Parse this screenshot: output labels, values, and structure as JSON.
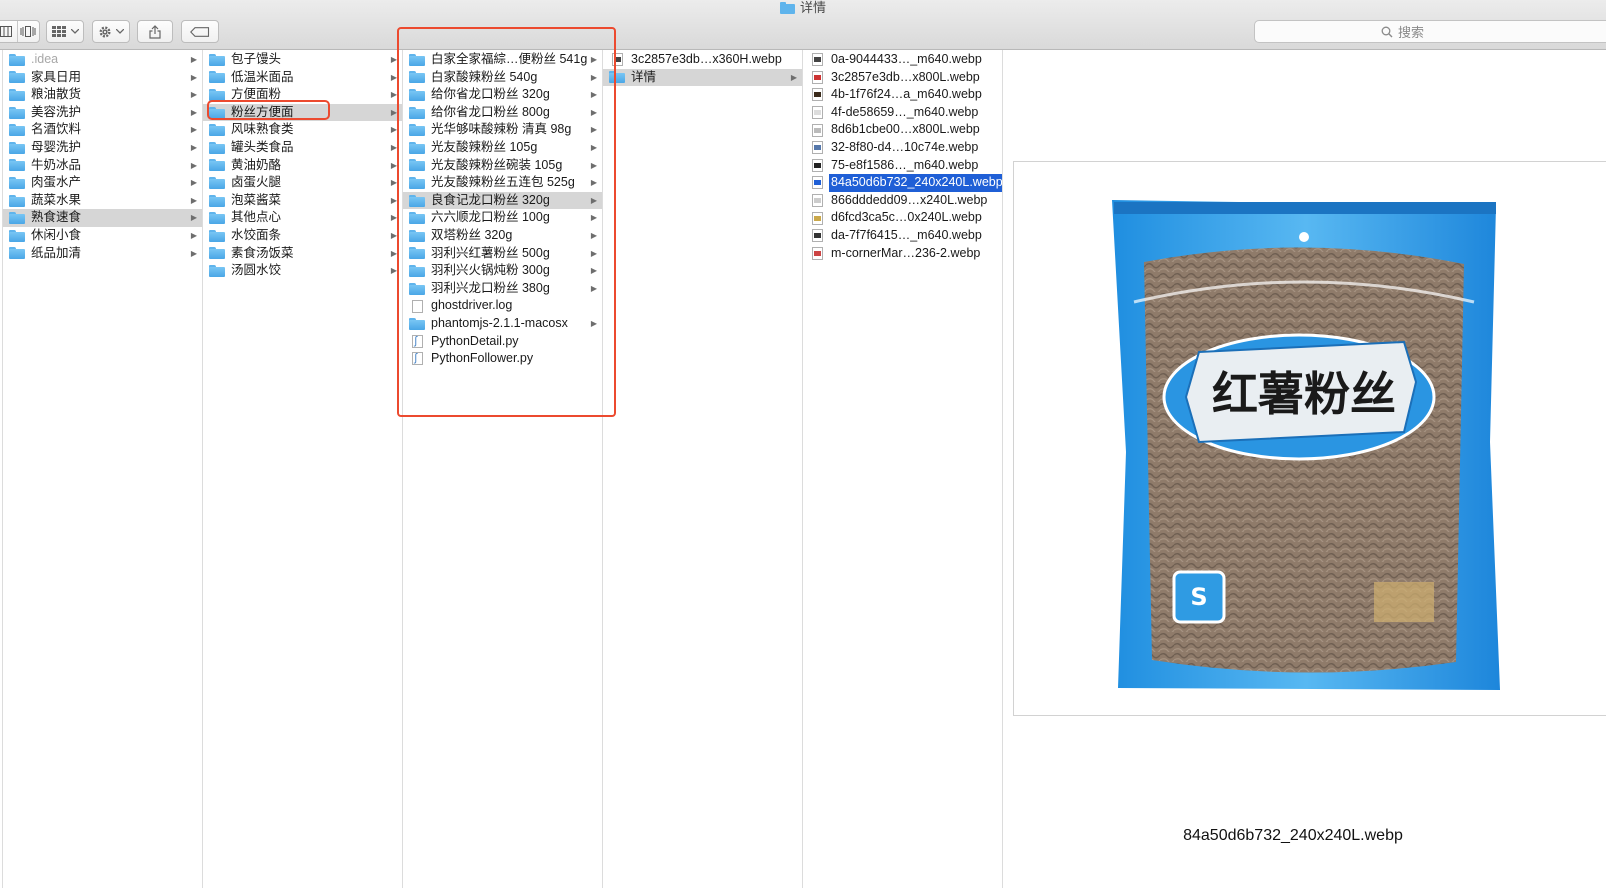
{
  "window": {
    "title": "详情"
  },
  "search": {
    "placeholder": "搜索"
  },
  "columns": {
    "c1": [
      {
        "label": ".idea",
        "kind": "folder",
        "dim": true,
        "arrow": true
      },
      {
        "label": "家具日用",
        "kind": "folder",
        "arrow": true
      },
      {
        "label": "粮油散货",
        "kind": "folder",
        "arrow": true
      },
      {
        "label": "美容洗护",
        "kind": "folder",
        "arrow": true
      },
      {
        "label": "名酒饮料",
        "kind": "folder",
        "arrow": true
      },
      {
        "label": "母婴洗护",
        "kind": "folder",
        "arrow": true
      },
      {
        "label": "牛奶冰品",
        "kind": "folder",
        "arrow": true
      },
      {
        "label": "肉蛋水产",
        "kind": "folder",
        "arrow": true
      },
      {
        "label": "蔬菜水果",
        "kind": "folder",
        "arrow": true
      },
      {
        "label": "熟食速食",
        "kind": "folder",
        "arrow": true,
        "selected": true
      },
      {
        "label": "休闲小食",
        "kind": "folder",
        "arrow": true
      },
      {
        "label": "纸品加清",
        "kind": "folder",
        "arrow": true
      }
    ],
    "c2": [
      {
        "label": "包子馒头",
        "kind": "folder",
        "arrow": true
      },
      {
        "label": "低温米面品",
        "kind": "folder",
        "arrow": true
      },
      {
        "label": "方便面粉",
        "kind": "folder",
        "arrow": true
      },
      {
        "label": "粉丝方便面",
        "kind": "folder",
        "arrow": true,
        "selected": true
      },
      {
        "label": "风味熟食类",
        "kind": "folder",
        "arrow": true
      },
      {
        "label": "罐头类食品",
        "kind": "folder",
        "arrow": true
      },
      {
        "label": "黄油奶酪",
        "kind": "folder",
        "arrow": true
      },
      {
        "label": "卤蛋火腿",
        "kind": "folder",
        "arrow": true
      },
      {
        "label": "泡菜酱菜",
        "kind": "folder",
        "arrow": true
      },
      {
        "label": "其他点心",
        "kind": "folder",
        "arrow": true
      },
      {
        "label": "水饺面条",
        "kind": "folder",
        "arrow": true
      },
      {
        "label": "素食汤饭菜",
        "kind": "folder",
        "arrow": true
      },
      {
        "label": "汤圆水饺",
        "kind": "folder",
        "arrow": true
      }
    ],
    "c3": [
      {
        "label": "白家全家福綜…便粉丝 541g",
        "kind": "folder",
        "arrow": true
      },
      {
        "label": "白家酸辣粉丝 540g",
        "kind": "folder",
        "arrow": true
      },
      {
        "label": "给你省龙口粉丝 320g",
        "kind": "folder",
        "arrow": true
      },
      {
        "label": "给你省龙口粉丝 800g",
        "kind": "folder",
        "arrow": true
      },
      {
        "label": "光华够味酸辣粉 清真 98g",
        "kind": "folder",
        "arrow": true
      },
      {
        "label": "光友酸辣粉丝 105g",
        "kind": "folder",
        "arrow": true
      },
      {
        "label": "光友酸辣粉丝碗装 105g",
        "kind": "folder",
        "arrow": true
      },
      {
        "label": "光友酸辣粉丝五连包 525g",
        "kind": "folder",
        "arrow": true
      },
      {
        "label": "良食记龙口粉丝 320g",
        "kind": "folder",
        "arrow": true,
        "selected": true
      },
      {
        "label": "六六顺龙口粉丝 100g",
        "kind": "folder",
        "arrow": true
      },
      {
        "label": "双塔粉丝 320g",
        "kind": "folder",
        "arrow": true
      },
      {
        "label": "羽利兴红薯粉丝 500g",
        "kind": "folder",
        "arrow": true
      },
      {
        "label": "羽利兴火锅炖粉 300g",
        "kind": "folder",
        "arrow": true
      },
      {
        "label": "羽利兴龙口粉丝 380g",
        "kind": "folder",
        "arrow": true
      },
      {
        "label": "ghostdriver.log",
        "kind": "doc",
        "arrow": false
      },
      {
        "label": "phantomjs-2.1.1-macosx",
        "kind": "folder",
        "arrow": true
      },
      {
        "label": "PythonDetail.py",
        "kind": "py",
        "arrow": false
      },
      {
        "label": "PythonFollower.py",
        "kind": "py",
        "arrow": false
      }
    ],
    "c4": [
      {
        "label": "3c2857e3db…x360H.webp",
        "kind": "thumb",
        "arrow": false
      },
      {
        "label": "详情",
        "kind": "folder",
        "arrow": true,
        "selected": true
      }
    ],
    "c5": [
      {
        "label": "0a-9044433…_m640.webp",
        "kind": "thumb"
      },
      {
        "label": "3c2857e3db…x800L.webp",
        "kind": "thumb"
      },
      {
        "label": "4b-1f76f24…a_m640.webp",
        "kind": "thumb"
      },
      {
        "label": "4f-de58659…_m640.webp",
        "kind": "thumb"
      },
      {
        "label": "8d6b1cbe00…x800L.webp",
        "kind": "thumb"
      },
      {
        "label": "32-8f80-d4…10c74e.webp",
        "kind": "thumb"
      },
      {
        "label": "75-e8f1586…_m640.webp",
        "kind": "thumb"
      },
      {
        "label": "84a50d6b732_240x240L.webp",
        "kind": "thumb",
        "selected_blue": true
      },
      {
        "label": "866dddedd09…x240L.webp",
        "kind": "thumb"
      },
      {
        "label": "d6fcd3ca5c…0x240L.webp",
        "kind": "thumb"
      },
      {
        "label": "da-7f7f6415…_m640.webp",
        "kind": "thumb"
      },
      {
        "label": "m-cornerMar…236-2.webp",
        "kind": "thumb"
      }
    ]
  },
  "preview": {
    "caption": "84a50d6b732_240x240L.webp",
    "product_text": "红薯粉丝"
  },
  "colors": {
    "accent": "#1f5fd6",
    "folder": "#5fb4ec",
    "callout": "#ec4a2f"
  }
}
